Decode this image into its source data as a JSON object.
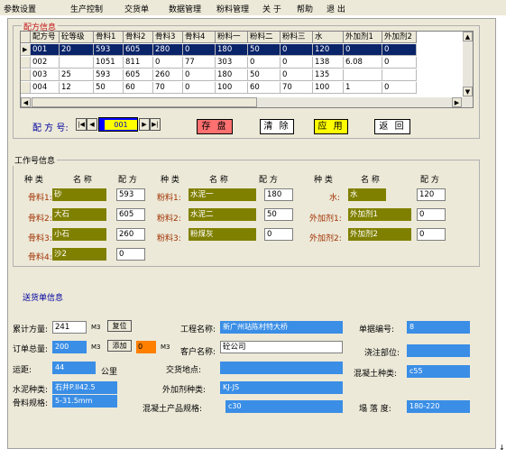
{
  "menu": [
    "参数设置",
    "生产控制",
    "交货单",
    "数据管理",
    "粉料管理",
    "关 于",
    "帮助",
    "退 出"
  ],
  "formula_section": {
    "title": "配方信息",
    "columns": [
      "配方号",
      "砼等级",
      "骨料1",
      "骨料2",
      "骨料3",
      "骨料4",
      "粉料一",
      "粉料二",
      "粉料三",
      "水",
      "外加剂1",
      "外加剂2"
    ],
    "rows": [
      [
        "001",
        "20",
        "593",
        "605",
        "280",
        "0",
        "180",
        "50",
        "0",
        "120",
        "0",
        "0"
      ],
      [
        "002",
        "",
        "1051",
        "811",
        "0",
        "77",
        "303",
        "0",
        "0",
        "138",
        "6.08",
        "0"
      ],
      [
        "003",
        "25",
        "593",
        "605",
        "260",
        "0",
        "180",
        "50",
        "0",
        "135",
        "",
        ""
      ],
      [
        "004",
        "12",
        "50",
        "60",
        "70",
        "0",
        "100",
        "60",
        "70",
        "100",
        "1",
        "0"
      ]
    ],
    "selected_row": 0,
    "nav_label": "配 方 号:",
    "nav_value": "001",
    "buttons": {
      "save": "存 盘",
      "clear": "清 除",
      "apply": "应 用",
      "back": "返 回"
    }
  },
  "work_section": {
    "title": "工作号信息",
    "headers": {
      "kind": "种 类",
      "name": "名 称",
      "formula": "配 方"
    },
    "aggregates": [
      {
        "label": "骨料1:",
        "name": "砂",
        "value": "593"
      },
      {
        "label": "骨料2:",
        "name": "大石",
        "value": "605"
      },
      {
        "label": "骨料3:",
        "name": "小石",
        "value": "260"
      },
      {
        "label": "骨料4:",
        "name": "沙2",
        "value": "0"
      }
    ],
    "powders": [
      {
        "label": "粉料1:",
        "name": "水泥一",
        "value": "180"
      },
      {
        "label": "粉料2:",
        "name": "水泥二",
        "value": "50"
      },
      {
        "label": "粉料3:",
        "name": "粉煤灰",
        "value": "0"
      }
    ],
    "others": [
      {
        "label": "水:",
        "name": "水",
        "value": "120"
      },
      {
        "label": "外加剂1:",
        "name": "外加剂1",
        "value": "0"
      },
      {
        "label": "外加剂2:",
        "name": "外加剂2",
        "value": "0"
      }
    ]
  },
  "delivery": {
    "title": "送货单信息",
    "cumulative_label": "累计方量:",
    "cumulative_value": "241",
    "unit": "M3",
    "reset_button": "复位",
    "order_label": "订单总量:",
    "order_value": "200",
    "add_button": "添加",
    "add_value": "0",
    "distance_label": "运距:",
    "distance_value": "44",
    "distance_unit": "公里",
    "cement_label": "水泥种类:",
    "cement_value": "石井P.II42.5",
    "aggregate_label": "骨料规格:",
    "aggregate_value": "5-31.5mm",
    "project_label": "工程名称:",
    "project_value": "新广州站陈村特大桥",
    "customer_label": "客户名称:",
    "customer_value": "砼公司",
    "delivery_place_label": "交货地点:",
    "delivery_place_value": "",
    "admixture_label": "外加剂种类:",
    "admixture_value": "KJ-JS",
    "product_spec_label": "混凝土产品规格:",
    "product_spec_value": "c30",
    "doc_no_label": "单据编号:",
    "doc_no_value": "8",
    "pour_part_label": "浇注部位:",
    "pour_part_value": "",
    "concrete_type_label": "混凝土种类:",
    "concrete_type_value": "c55",
    "slump_label": "塌 落 度:",
    "slump_value": "180-220"
  },
  "colors": {
    "olive": "#808000",
    "blue_field": "#3a8ee6",
    "save_btn": "#ff7070",
    "apply_btn": "#ffff00",
    "selection": "#0a246a"
  }
}
